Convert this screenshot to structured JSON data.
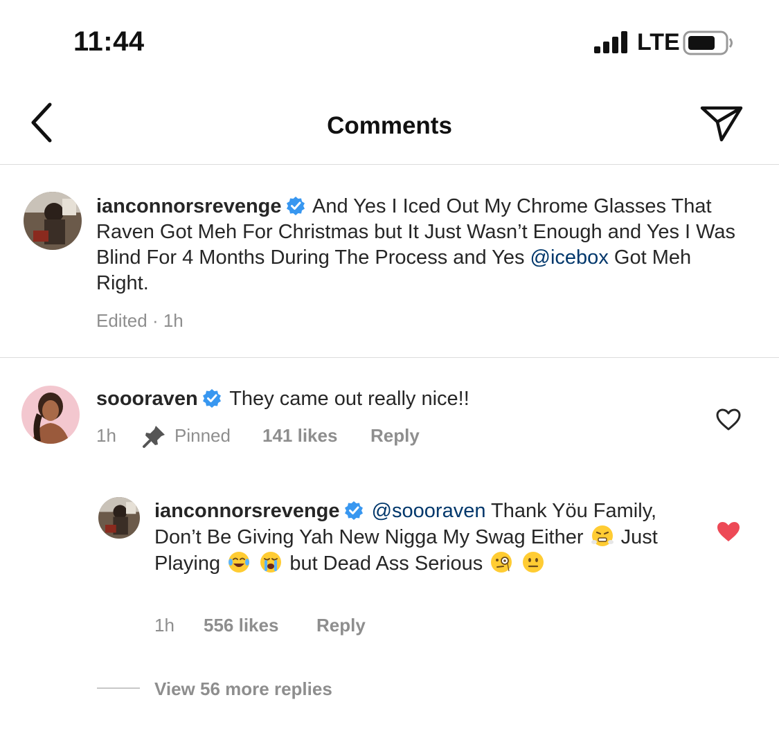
{
  "status_bar": {
    "time": "11:44",
    "network": "LTE",
    "icons": [
      "signal-icon",
      "battery-icon"
    ]
  },
  "header": {
    "title": "Comments",
    "back_icon": "chevron-left-icon",
    "share_icon": "send-icon"
  },
  "caption": {
    "username": "ianconnorsrevenge",
    "verified": true,
    "text_part1": "And Yes I Iced Out My Chrome Glasses That Raven Got Meh For Christmas but It Just Wasn’t Enough and Yes I Was Blind For 4 Months During The Process and Yes",
    "mention": "@icebox",
    "text_part2": "Got Meh Right.",
    "meta": "Edited · 1h"
  },
  "comment": {
    "username": "soooraven",
    "verified": true,
    "text": "They came out really nice!!",
    "time": "1h",
    "pinned_label": "Pinned",
    "likes": "141 likes",
    "reply_label": "Reply",
    "liked": false
  },
  "reply": {
    "username": "ianconnorsrevenge",
    "verified": true,
    "mention": "@soooraven",
    "text_part1": "Thank Yöu Family, Don’t Be Giving Yah New Nigga My Swag Either",
    "text_part2": "Just Playing",
    "text_part3": "but Dead Ass Serious",
    "emojis": [
      "steam-face-emoji",
      "tears-of-joy-emoji",
      "loudly-crying-emoji",
      "monocle-face-emoji",
      "neutral-face-emoji"
    ],
    "time": "1h",
    "likes": "556 likes",
    "reply_label": "Reply",
    "liked": true
  },
  "view_more": "View 56 more replies",
  "colors": {
    "verified": "#3897f0",
    "heart_liked": "#ed4956",
    "mention": "#00376b",
    "meta": "#8e8e8e"
  }
}
